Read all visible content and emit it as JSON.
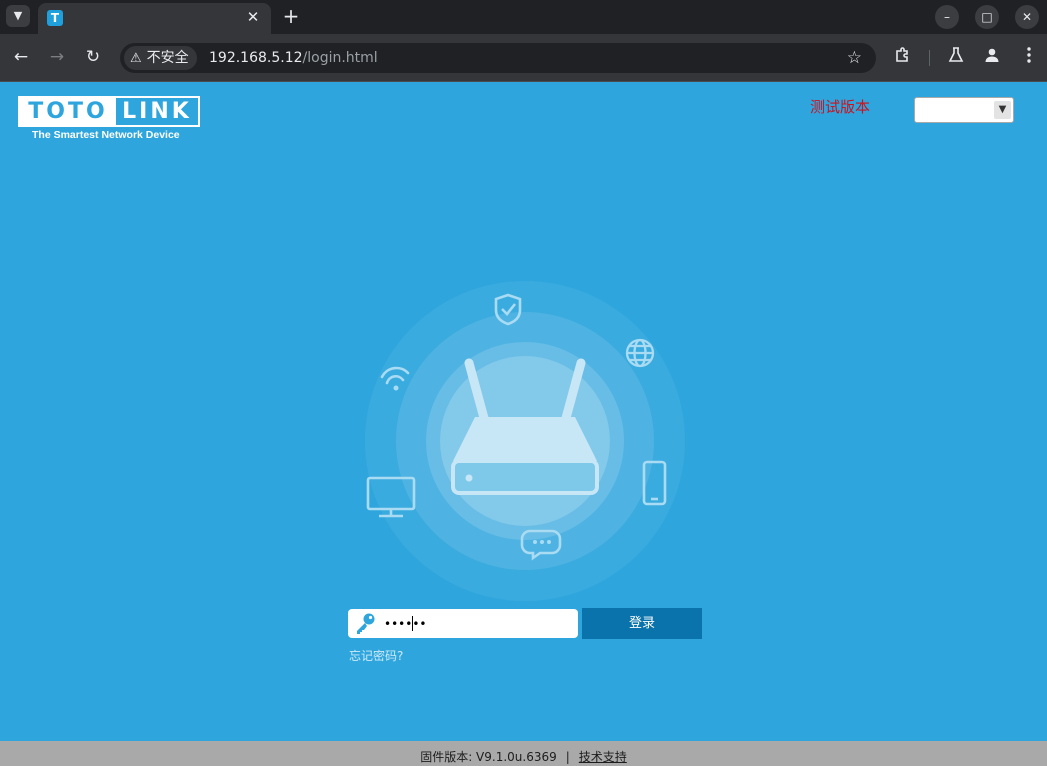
{
  "browser": {
    "tab_favicon": "T",
    "tab_close_icon": "close-icon",
    "new_tab_symbol": "+",
    "security_label": "不安全",
    "url_host": "192.168.5.12",
    "url_path": "/login.html"
  },
  "page": {
    "logo_left": "TOTO",
    "logo_right": "LINK",
    "logo_tagline": "The Smartest Network Device",
    "test_version_label": "测试版本",
    "language_selected": "",
    "password_value": "••••••",
    "login_button": "登录",
    "forgot_password": "忘记密码?",
    "firmware_label": "固件版本: V9.1.0u.6369",
    "footer_separator": "|",
    "support_link": "技术支持"
  },
  "colors": {
    "page_background": "#2ea6dd",
    "login_button": "#0a73ab",
    "test_version_text": "#d0101d",
    "footer_background": "#a9a9a9"
  }
}
